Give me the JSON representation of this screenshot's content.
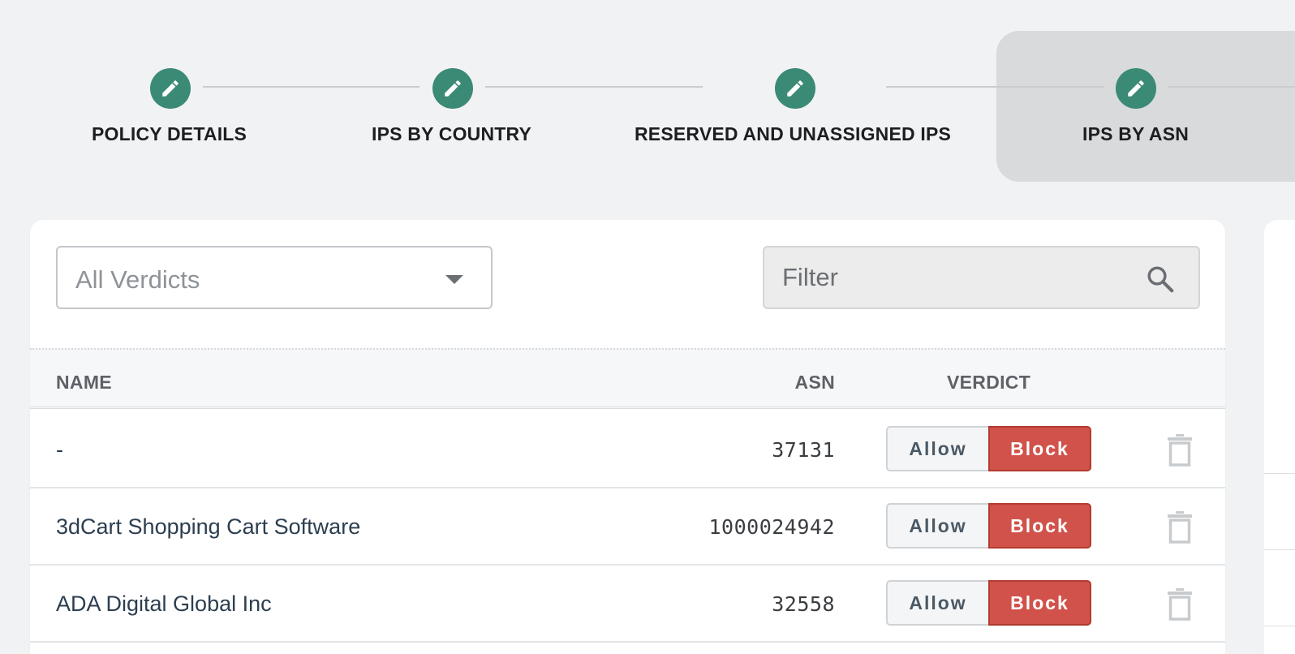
{
  "stepper": {
    "steps": [
      {
        "label": "POLICY DETAILS",
        "icon": "pencil-icon"
      },
      {
        "label": "IPS BY COUNTRY",
        "icon": "pencil-icon"
      },
      {
        "label": "RESERVED AND UNASSIGNED IPS",
        "icon": "pencil-icon"
      },
      {
        "label": "IPS BY ASN",
        "icon": "pencil-icon",
        "active": true
      }
    ]
  },
  "toolbar": {
    "verdict_select": {
      "value": "All Verdicts",
      "icon": "chevron-down-icon"
    },
    "filter": {
      "placeholder": "Filter",
      "icon": "search-icon"
    }
  },
  "table": {
    "columns": {
      "name": "NAME",
      "asn": "ASN",
      "verdict": "VERDICT"
    },
    "rows": [
      {
        "name": "-",
        "asn": "37131",
        "allow_label": "Allow",
        "block_label": "Block",
        "verdict": "Block"
      },
      {
        "name": "3dCart Shopping Cart Software",
        "asn": "1000024942",
        "allow_label": "Allow",
        "block_label": "Block",
        "verdict": "Block"
      },
      {
        "name": "ADA Digital Global Inc",
        "asn": "32558",
        "allow_label": "Allow",
        "block_label": "Block",
        "verdict": "Block"
      }
    ]
  },
  "colors": {
    "step_icon": "#3b8a75",
    "block_active": "#d1524a",
    "page_background": "#f1f2f4"
  }
}
